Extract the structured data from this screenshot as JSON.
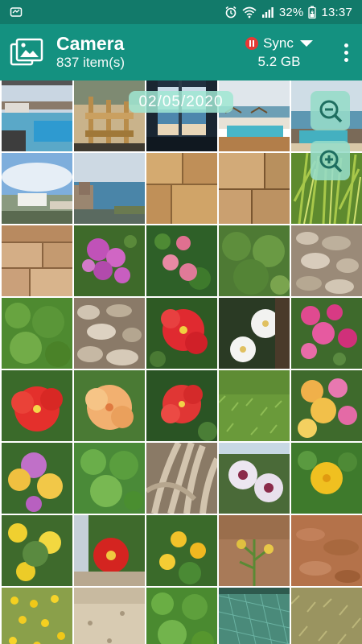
{
  "status_bar": {
    "battery_percent": "32%",
    "time": "13:37",
    "icons": [
      "notification-icon",
      "alarm-icon",
      "wifi-icon",
      "signal-icon",
      "battery-icon"
    ]
  },
  "header": {
    "title": "Camera",
    "subtitle": "837 item(s)",
    "sync_label": "Sync",
    "size": "5.2 GB",
    "icons": [
      "gallery-icon",
      "pause-icon",
      "caret-down-icon",
      "more-vert-icon"
    ]
  },
  "overlay": {
    "date": "02/05/2020",
    "zoom_out_icon": "zoom-out-icon",
    "zoom_in_icon": "zoom-in-icon"
  },
  "colors": {
    "status_bar": "#127a6a",
    "app_bar": "#149180",
    "overlay_chip": "#a0e6d2",
    "pause_red": "#e53935"
  },
  "photos": [
    "pool-resort-photo",
    "bamboo-chairs-photo",
    "sea-view-balcony-photo",
    "beach-terrace-photo",
    "seaside-pool-photo",
    "hotel-coast-photo",
    "harbor-view-photo",
    "stone-wall-photo",
    "stone-wall-photo",
    "green-shrub-photo",
    "stone-blocks-photo",
    "bougainvillea-photo",
    "pink-flowers-photo",
    "green-bush-photo",
    "stone-pile-photo",
    "green-bush-photo",
    "rocks-photo",
    "red-hibiscus-photo",
    "white-flowers-photo",
    "pink-bougainvillea-photo",
    "red-hibiscus-photo",
    "peach-hibiscus-photo",
    "red-hibiscus-photo",
    "grass-photo",
    "lantana-photo",
    "lantana-photo",
    "green-plant-photo",
    "tree-bark-photo",
    "pink-white-flowers-photo",
    "yellow-lantana-photo",
    "yellow-lantana-photo",
    "red-hibiscus-photo",
    "yellow-lantana-photo",
    "dry-plant-photo",
    "red-soil-photo",
    "yellow-wildflowers-photo",
    "sandy-ground-photo",
    "green-ground-cover-photo",
    "shade-net-photo",
    "dry-grass-photo"
  ]
}
